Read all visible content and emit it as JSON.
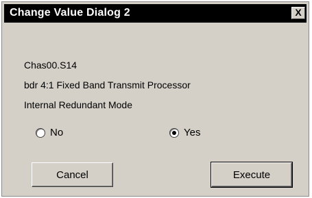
{
  "dialog": {
    "title": "Change Value Dialog 2",
    "close_label": "X",
    "lines": [
      "Chas00.S14",
      "bdr 4:1 Fixed Band Transmit Processor",
      "Internal Redundant Mode"
    ],
    "options": [
      {
        "label": "No",
        "selected": false
      },
      {
        "label": "Yes",
        "selected": true
      }
    ],
    "cancel_label": "Cancel",
    "execute_label": "Execute"
  }
}
